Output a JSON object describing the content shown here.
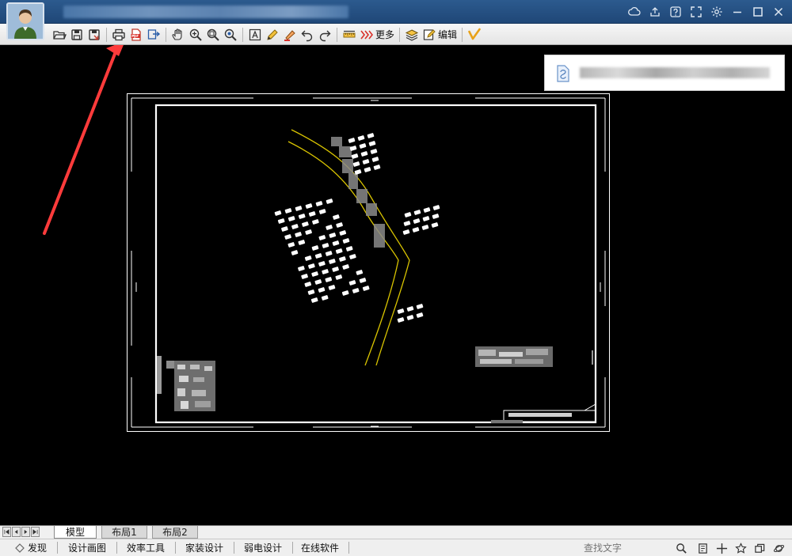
{
  "window": {
    "title": "████████████ ████ ██████████████████"
  },
  "toolbar": {
    "more_label": "更多",
    "edit_label": "编辑"
  },
  "notification": {
    "text": "████████ ████ ██████ ███"
  },
  "layout_tabs": [
    "模型",
    "布局1",
    "布局2"
  ],
  "menu": {
    "discover": "发现",
    "design_drawing": "设计画图",
    "efficiency_tools": "效率工具",
    "home_design": "家装设计",
    "weak_current": "弱电设计",
    "online_software": "在线软件"
  },
  "search": {
    "placeholder": "查找文字"
  },
  "colors": {
    "titlebar": "#2c5a8e",
    "canvas": "#000000",
    "road": "#d9c400",
    "drawing_lines": "#ffffff",
    "annotation_arrow": "#ff3b3b"
  }
}
